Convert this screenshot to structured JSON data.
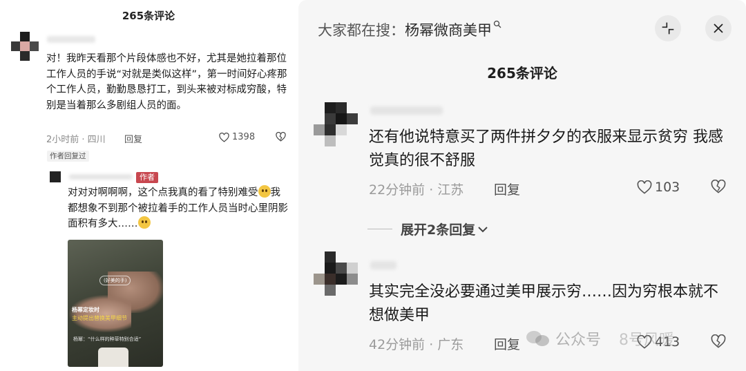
{
  "left_panel": {
    "title": "265条评论",
    "comment": {
      "text": "对！我昨天看那个片段体感也不好，尤其是她拉着那位工作人员的手说“对就是类似这样”，第一时间好心疼那个工作人员，勤勤恳恳打工，到头来被对标成穷酸，特别是当着那么多剧组人员的面。",
      "time_location": "2小时前 · 四川",
      "reply_label": "回复",
      "likes": "1398",
      "author_replied_badge": "作者回复过"
    },
    "sub_reply": {
      "author_tag": "作者",
      "text_part1": "对对对啊啊啊，这个点我真的看了特别难受",
      "text_part2": "我都想象不到那个被拉着手的工作人员当时心里阴影面积有多大……",
      "thumbnail": {
        "bubble_text": "(好美的手)",
        "caption_line1": "杨幂定妆时",
        "caption_line2": "主动提出替换美甲细节",
        "caption_line3": "杨幂：“什么样的种草特别合适”"
      }
    }
  },
  "right_panel": {
    "search_label": "大家都在搜：",
    "search_query": "杨幂微商美甲",
    "title": "265条评论",
    "comments": [
      {
        "text": "还有他说特意买了两件拼夕夕的衣服来显示贫穷 我感觉真的很不舒服",
        "time_location": "22分钟前 · 江苏",
        "reply_label": "回复",
        "likes": "103"
      },
      {
        "text": "其实完全没必要通过美甲展示穷……因为穷根本就不想做美甲",
        "time_location": "42分钟前 · 广东",
        "reply_label": "回复",
        "likes": "413"
      }
    ],
    "expand_replies": "展开2条回复",
    "watermark_text": "公众号",
    "watermark_text2": "8号风暖"
  }
}
